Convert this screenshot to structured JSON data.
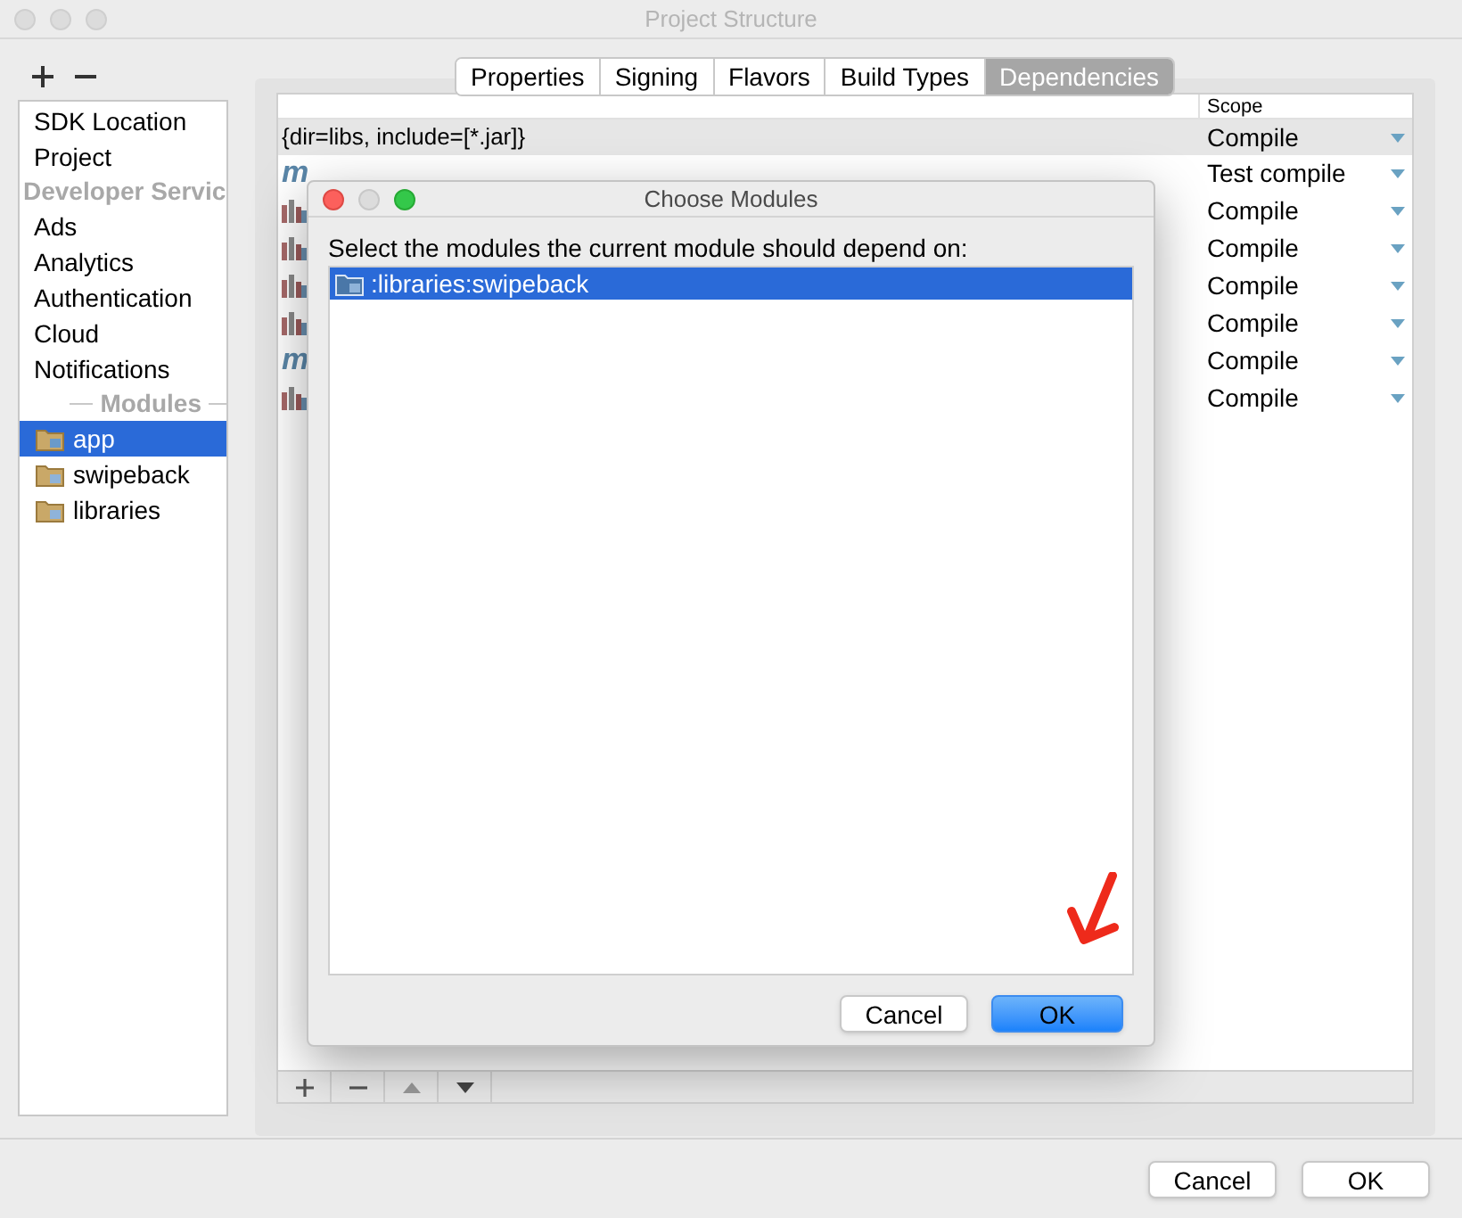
{
  "window": {
    "title": "Project Structure"
  },
  "sidebar": {
    "items": [
      {
        "kind": "item",
        "label": "SDK Location",
        "selected": false
      },
      {
        "kind": "item",
        "label": "Project",
        "selected": false
      },
      {
        "kind": "header",
        "label": "Developer Servic"
      },
      {
        "kind": "item",
        "label": "Ads",
        "selected": false
      },
      {
        "kind": "item",
        "label": "Analytics",
        "selected": false
      },
      {
        "kind": "item",
        "label": "Authentication",
        "selected": false
      },
      {
        "kind": "item",
        "label": "Cloud",
        "selected": false
      },
      {
        "kind": "item",
        "label": "Notifications",
        "selected": false
      },
      {
        "kind": "section",
        "label": "Modules"
      },
      {
        "kind": "module",
        "label": "app",
        "selected": true
      },
      {
        "kind": "module",
        "label": "swipeback",
        "selected": false
      },
      {
        "kind": "module",
        "label": "libraries",
        "selected": false
      }
    ]
  },
  "tabs": [
    {
      "label": "Properties",
      "selected": false
    },
    {
      "label": "Signing",
      "selected": false
    },
    {
      "label": "Flavors",
      "selected": false
    },
    {
      "label": "Build Types",
      "selected": false
    },
    {
      "label": "Dependencies",
      "selected": true
    }
  ],
  "table": {
    "columns": [
      "Scope"
    ],
    "rows": [
      {
        "kind": "file",
        "text": "{dir=libs, include=[*.jar]}",
        "scope": "Compile",
        "selected": true
      },
      {
        "kind": "maven",
        "icon": "m",
        "scope": "Test compile",
        "selected": false
      },
      {
        "kind": "library",
        "scope": "Compile",
        "selected": false
      },
      {
        "kind": "library",
        "scope": "Compile",
        "selected": false
      },
      {
        "kind": "library",
        "scope": "Compile",
        "selected": false
      },
      {
        "kind": "library",
        "scope": "Compile",
        "selected": false
      },
      {
        "kind": "maven",
        "icon": "m",
        "scope": "Compile",
        "selected": false
      },
      {
        "kind": "library",
        "scope": "Compile",
        "selected": false
      }
    ]
  },
  "dialog": {
    "title": "Choose Modules",
    "prompt": "Select the modules the current module should depend on:",
    "items": [
      {
        "label": ":libraries:swipeback",
        "selected": true
      }
    ],
    "buttons": [
      {
        "label": "Cancel",
        "kind": "secondary"
      },
      {
        "label": "OK",
        "kind": "primary"
      }
    ]
  },
  "buttons": [
    {
      "label": "Cancel",
      "kind": "secondary"
    },
    {
      "label": "OK",
      "kind": "secondary"
    }
  ]
}
